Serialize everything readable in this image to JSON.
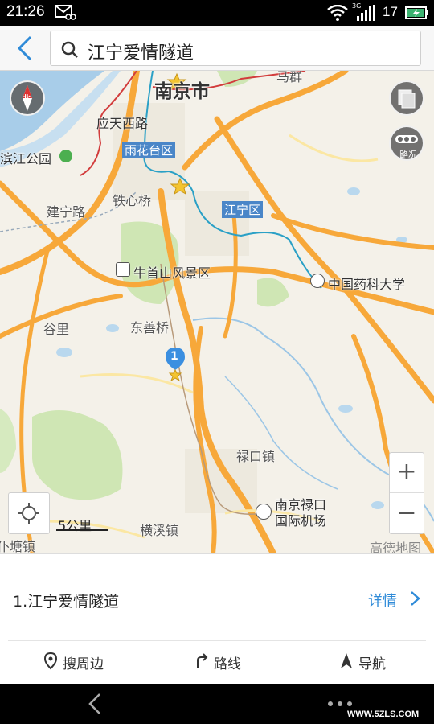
{
  "status_bar": {
    "time": "21:26",
    "signal_badge": "3G",
    "battery_level": "17"
  },
  "search": {
    "query": "江宁爱情隧道"
  },
  "map": {
    "labels": {
      "city": "南京市",
      "yutai_road": "应天西路",
      "yuhuatai": "雨花台区",
      "binjiang_park": "滨江公园",
      "tiexin_bridge": "铁心桥",
      "jianning_road": "建宁路",
      "jiangning_district": "江宁区",
      "niushou_mountain": "牛首山风景区",
      "pharma_univ": "中国药科大学",
      "guli": "谷里",
      "dongshan_bridge": "东善桥",
      "lukou_town": "禄口镇",
      "airport_line1": "南京禄口",
      "airport_line2": "国际机场",
      "hengxi_town": "横溪镇",
      "putang_town": "仆塘镇",
      "top_right": "马群"
    },
    "compass_label": "北",
    "traffic_label": "路况",
    "pin_number": "1",
    "scale": "5公里",
    "provider": "高德地图",
    "zoom_in": "+",
    "zoom_out": "−"
  },
  "result": {
    "title": "1.江宁爱情隧道",
    "details_label": "详情"
  },
  "actions": {
    "nearby": "搜周边",
    "route": "路线",
    "navigate": "导航"
  },
  "watermark": "WWW.5ZLS.COM",
  "colors": {
    "accent": "#2f8bd8",
    "road": "#f7a83a",
    "water": "#a8cde9",
    "park": "#cfe6b4"
  }
}
